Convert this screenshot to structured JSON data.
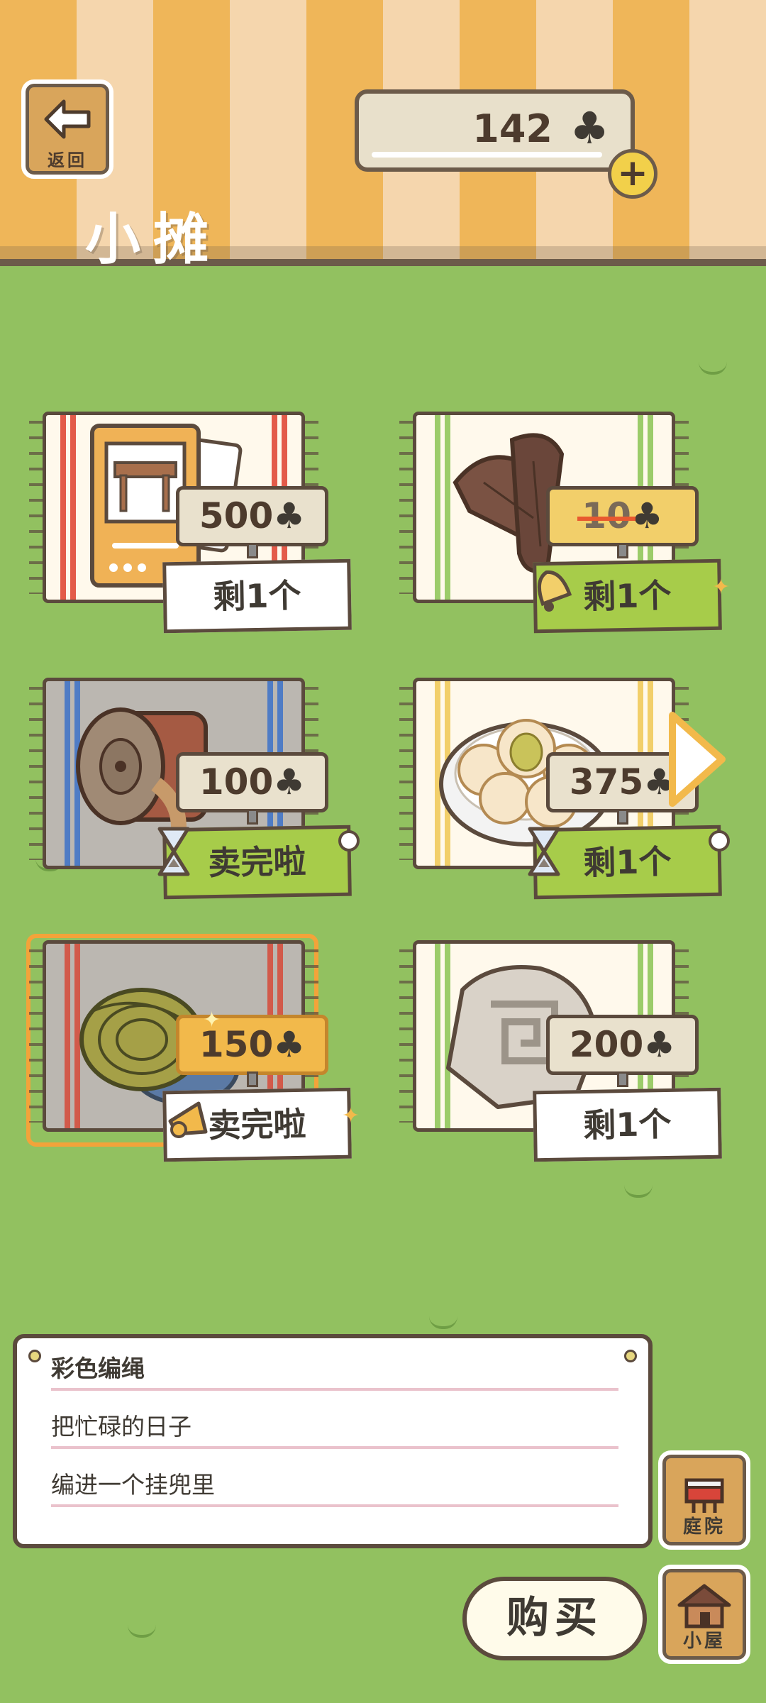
{
  "header": {
    "back_label": "返回",
    "title": "小摊",
    "currency_amount": "142",
    "currency_icon": "clover-icon",
    "plus_label": "+"
  },
  "items": [
    {
      "id": "furniture-card",
      "price": "500",
      "status": "剩1个",
      "status_style": "white",
      "price_style": "normal"
    },
    {
      "id": "driftwood",
      "price": "10",
      "status": "剩1个",
      "status_style": "green",
      "price_style": "struck"
    },
    {
      "id": "wooden-spool",
      "price": "100",
      "status": "卖完啦",
      "status_style": "green",
      "price_style": "normal"
    },
    {
      "id": "dumplings",
      "price": "375",
      "status": "剩1个",
      "status_style": "green",
      "price_style": "normal"
    },
    {
      "id": "colorful-rope",
      "price": "150",
      "status": "卖完啦",
      "status_style": "white",
      "price_style": "sale"
    },
    {
      "id": "stone",
      "price": "200",
      "status": "剩1个",
      "status_style": "white",
      "price_style": "normal"
    }
  ],
  "description": {
    "title": "彩色编绳",
    "line1": "把忙碌的日子",
    "line2": "编进一个挂兜里"
  },
  "buttons": {
    "buy": "购买",
    "yard": "庭院",
    "house": "小屋"
  },
  "colors": {
    "grass": "#92c160",
    "banner_orange": "#efb659",
    "banner_cream": "#f5d6ad",
    "outline": "#5b4a3d",
    "highlight": "#f3a33a"
  }
}
